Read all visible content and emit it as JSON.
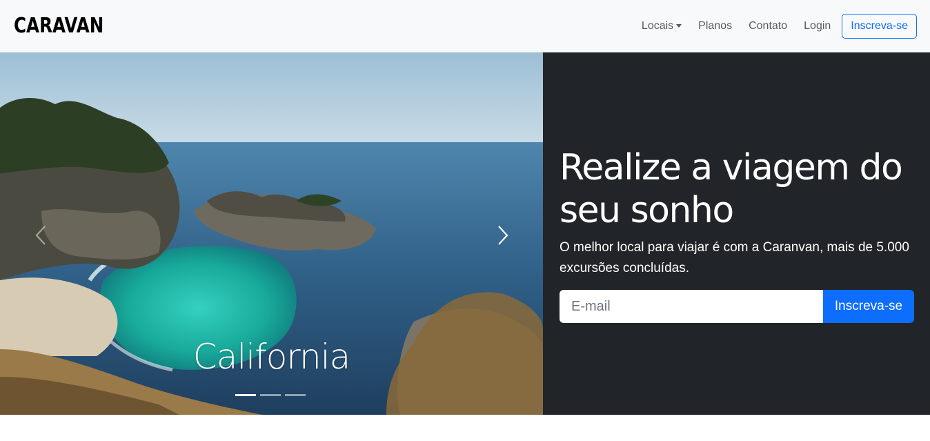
{
  "navbar": {
    "brand": "CARAVAN",
    "links": [
      {
        "label": "Locais"
      },
      {
        "label": "Planos"
      },
      {
        "label": "Contato"
      },
      {
        "label": "Login"
      }
    ],
    "cta_label": "Inscreva-se"
  },
  "carousel": {
    "caption": "California",
    "slide_count": 3,
    "active_slide": 1
  },
  "hero": {
    "headline": "Realize a viagem do seu sonho",
    "lead": "O melhor local para viajar é com a Caranvan, mais de 5.000 excursões concluídas.",
    "email_placeholder": "E-mail",
    "submit_label": "Inscreva-se"
  },
  "colors": {
    "primary": "#0d6efd",
    "dark_panel": "#212529",
    "navbar_bg": "#f8f9fa"
  }
}
